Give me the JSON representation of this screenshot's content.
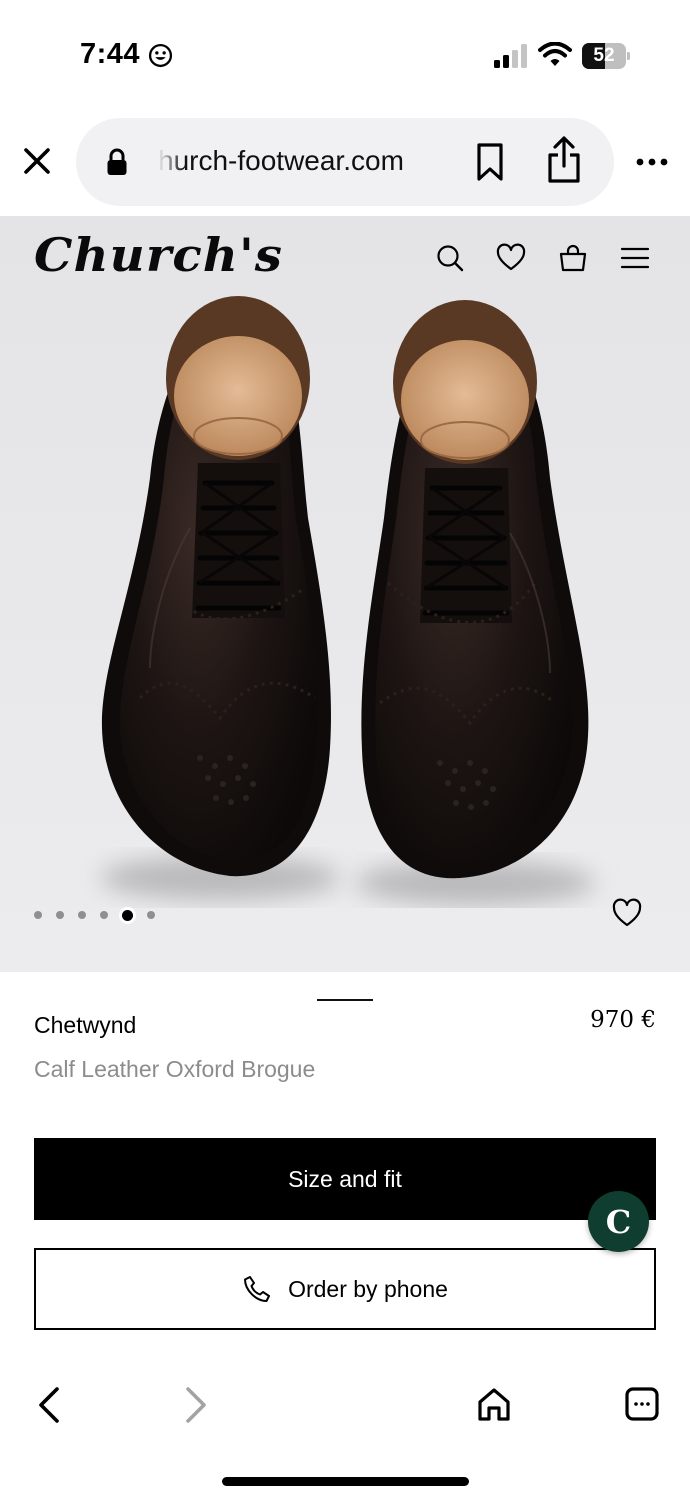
{
  "status_bar": {
    "time": "7:44",
    "battery": "52",
    "battery_level": 0.52
  },
  "browser": {
    "url": "hurch-footwear.com",
    "icons": [
      "close-icon",
      "lock-icon",
      "bookmark-icon",
      "share-icon",
      "more-icon"
    ]
  },
  "site": {
    "logo": "Church's",
    "nav_icons": [
      "search-icon",
      "heart-icon",
      "bag-icon",
      "menu-icon"
    ]
  },
  "carousel": {
    "total": 6,
    "active_index": 4
  },
  "product": {
    "name": "Chetwynd",
    "price": "970 €",
    "description": "Calf Leather Oxford Brogue"
  },
  "actions": {
    "size_label": "Size and fit",
    "phone_label": "Order by phone"
  },
  "chat": {
    "badge_letter": "C"
  },
  "toolbar": {
    "icons": [
      "back-icon",
      "forward-icon",
      "home-icon",
      "tabs-icon"
    ]
  },
  "colors": {
    "hero_background": "#e6e6e8",
    "chat_badge": "#0f3d30",
    "muted_text": "#8c8c8c"
  }
}
